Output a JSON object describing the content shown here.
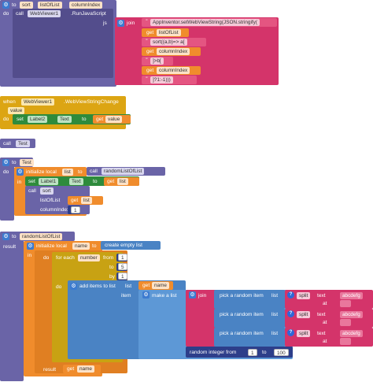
{
  "colors": {
    "procedure": "#6a64a7",
    "text": "#d4346a",
    "variable": "#f08c2c",
    "component": "#2e8b3c",
    "control": "#c8a213",
    "list": "#4a83c4",
    "math": "#2d3e8a"
  },
  "sort_proc": {
    "to": "to",
    "name": "sort",
    "param1": "listOfList",
    "param2": "columnIndex",
    "do": "do",
    "call": "call",
    "component": "WebViewer1",
    "method": ".RunJavaScript",
    "js": "js",
    "join": "join",
    "s1": "AppInventor.setWebViewString(JSON.stringify(",
    "get1": "get",
    "var1": "listOfList",
    "s2": "sort((a,b)=> a[",
    "get2": "get",
    "var2": "columnIndex",
    "s3": "]>b[",
    "get3": "get",
    "var3": "columnIndex",
    "s4": "]?1:-1)))"
  },
  "event": {
    "when": "when",
    "component": "WebViewer1",
    "event": ".WebViewStringChange",
    "param": "value",
    "do": "do",
    "set": "set",
    "target": "Label2",
    "prop": "Text",
    "to": "to",
    "get": "get",
    "var": "value"
  },
  "call_test": {
    "call": "call",
    "name": "Test"
  },
  "test_proc": {
    "to": "to",
    "name": "Test",
    "do": "do",
    "init": "initialize local",
    "var": "list",
    "to2": "to",
    "call": "call",
    "fn": "randomListOfList",
    "in": "in",
    "set": "set",
    "target": "Label1",
    "prop": "Text",
    "to3": "to",
    "get": "get",
    "getvar": "list",
    "call2": "call",
    "sort": "sort",
    "p1": "listOfList",
    "get2": "get",
    "getvar2": "list",
    "p2": "columnIndex",
    "num": "1"
  },
  "rand_proc": {
    "to": "to",
    "name": "randomListOfList",
    "result": "result",
    "init": "initialize local",
    "var": "name",
    "to2": "to",
    "create": "create empty list",
    "in": "in",
    "do": "do",
    "foreach": "for each",
    "number": "number",
    "from": "from",
    "from_v": "1",
    "to3": "to",
    "to_v": "5",
    "by": "by",
    "by_v": "1",
    "do2": "do",
    "additems": "add items to list",
    "list": "list",
    "get": "get",
    "getvar": "name",
    "item": "item",
    "makelist": "make a list",
    "join": "join",
    "pick": "pick a random item",
    "listlbl": "list",
    "split": "split",
    "textlbl": "text",
    "at": "at",
    "abc": "abcdefg",
    "randint": "random integer from",
    "ri_from": "1",
    "ri_to": "to",
    "ri_to_v": "100",
    "result2": "result",
    "get2": "get",
    "getvar2": "name"
  }
}
